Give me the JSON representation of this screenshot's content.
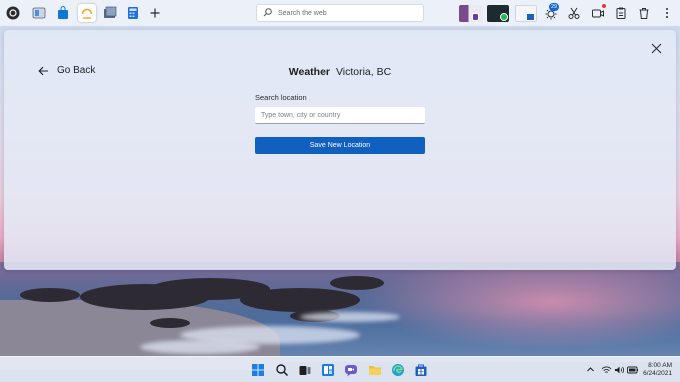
{
  "topbar": {
    "search_placeholder": "Search the web",
    "notification_count": "29",
    "launcher_icons": [
      "circle-app-icon",
      "files-icon",
      "store-icon",
      "weather-app-icon",
      "photos-icon",
      "calculator-icon",
      "add-icon"
    ],
    "right_icons": [
      "brightness-icon",
      "scissors-icon",
      "camera-record-icon",
      "clipboard-icon",
      "trash-icon",
      "more-icon"
    ]
  },
  "app": {
    "back_label": "Go Back",
    "app_name": "Weather",
    "location": "Victoria, BC",
    "search_label": "Search location",
    "search_placeholder": "Type town, city or country",
    "save_label": "Save New Location"
  },
  "taskbar": {
    "apps": [
      "start-icon",
      "search-icon",
      "task-view-icon",
      "widgets-icon",
      "chat-icon",
      "file-explorer-icon",
      "edge-icon",
      "store-icon"
    ],
    "tray": [
      "chevron-up-icon",
      "wifi-icon",
      "volume-icon",
      "battery-icon"
    ],
    "time": "8:00 AM",
    "date": "6/24/2021"
  },
  "colors": {
    "accent": "#1060c0",
    "window_bg": "#e4eaf6",
    "topbar_bg": "#eef2fa"
  }
}
